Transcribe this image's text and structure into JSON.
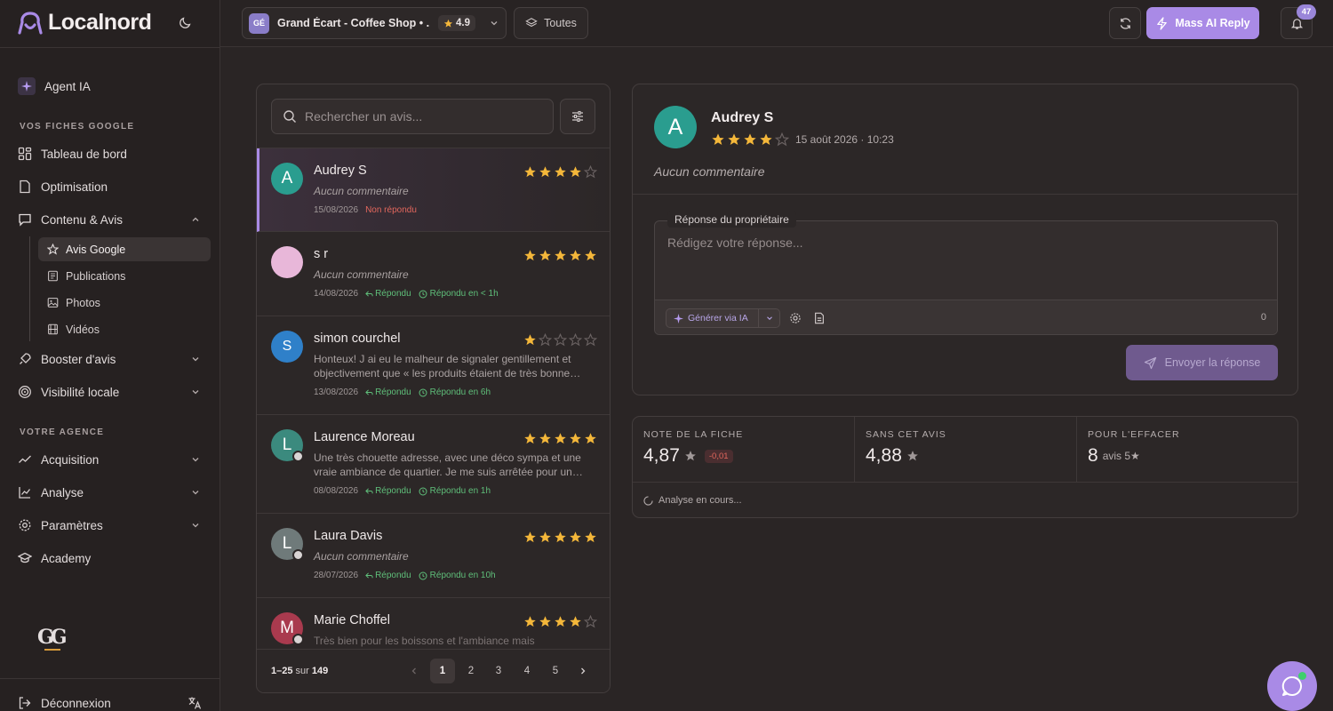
{
  "app": {
    "name": "Localnord"
  },
  "colors": {
    "accent": "#a98ae6",
    "star": "#f4b73a",
    "star_empty": "#6a6262",
    "red": "#e2675d",
    "green": "#5fbf7a"
  },
  "sidebar": {
    "agent_label": "Agent IA",
    "section_google": "VOS FICHES GOOGLE",
    "dashboard": "Tableau de bord",
    "optimisation": "Optimisation",
    "content": "Contenu & Avis",
    "sub_items": [
      "Avis Google",
      "Publications",
      "Photos",
      "Vidéos"
    ],
    "booster": "Booster d'avis",
    "visibility": "Visibilité locale",
    "section_agency": "VOTRE AGENCE",
    "acquisition": "Acquisition",
    "analyse": "Analyse",
    "parametres": "Paramètres",
    "academy": "Academy",
    "agency_logo": "GG",
    "logout": "Déconnexion"
  },
  "topbar": {
    "business_initials": "GÉ",
    "business_name": "Grand Écart - Coffee Shop • ...",
    "business_rating": "4.9",
    "filter_label": "Toutes",
    "mass_ai_label": "Mass AI Reply",
    "notif_count": "47"
  },
  "list": {
    "search_placeholder": "Rechercher un avis...",
    "reviews": [
      {
        "initial": "A",
        "name": "Audrey S",
        "rating": 4,
        "text": "Aucun commentaire",
        "date": "15/08/2026",
        "status": "Non répondu",
        "time": "",
        "color": "#2a9d8f"
      },
      {
        "initial": "",
        "name": "s r",
        "rating": 5,
        "text": "Aucun commentaire",
        "date": "14/08/2026",
        "status": "Répondu",
        "time": "Répondu en < 1h",
        "color": "#e8b7d9"
      },
      {
        "initial": "S",
        "name": "simon courchel",
        "rating": 1,
        "text": "Honteux! J ai eu le malheur de signaler gentillement et objectivement que « les produits étaient de très bonne…",
        "date": "13/08/2026",
        "status": "Répondu",
        "time": "Répondu en 6h",
        "color": "#2f80c9"
      },
      {
        "initial": "L",
        "name": "Laurence Moreau",
        "rating": 5,
        "text": "Une très chouette adresse, avec une déco sympa et une vraie ambiance de quartier. Je me suis arrêtée pour un…",
        "date": "08/08/2026",
        "status": "Répondu",
        "time": "Répondu en 1h",
        "color": "#3b8a7e"
      },
      {
        "initial": "L",
        "name": "Laura Davis",
        "rating": 5,
        "text": "Aucun commentaire",
        "date": "28/07/2026",
        "status": "Répondu",
        "time": "Répondu en 10h",
        "color": "#6f7a7a"
      },
      {
        "initial": "M",
        "name": "Marie Choffel",
        "rating": 4,
        "text": "Très bien pour les boissons et l'ambiance mais",
        "date": "",
        "status": "",
        "time": "",
        "color": "#a93a4e"
      }
    ],
    "pagination": {
      "range": "1–25",
      "of": "sur",
      "total": "149",
      "pages": [
        "1",
        "2",
        "3",
        "4",
        "5"
      ],
      "current": "1"
    }
  },
  "detail": {
    "initial": "A",
    "name": "Audrey S",
    "rating": 4,
    "date": "15 août 2026 · 10:23",
    "comment": "Aucun commentaire",
    "reply_legend": "Réponse du propriétaire",
    "reply_placeholder": "Rédigez votre réponse...",
    "generate_label": "Générer via IA",
    "char_count": "0",
    "send_label": "Envoyer la réponse"
  },
  "stats": {
    "note_label": "NOTE DE LA FICHE",
    "note_value": "4,87",
    "note_delta": "-0,01",
    "without_label": "SANS CET AVIS",
    "without_value": "4,88",
    "erase_label": "POUR L'EFFACER",
    "erase_value": "8",
    "erase_unit": "avis 5★",
    "analysing": "Analyse en cours..."
  }
}
